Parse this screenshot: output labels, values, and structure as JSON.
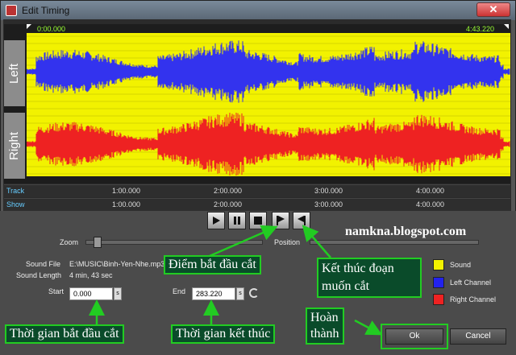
{
  "window": {
    "title": "Edit Timing",
    "close_label": "✕"
  },
  "waveform": {
    "start_time": "0:00.000",
    "end_time": "4:43.220",
    "left_label": "Left",
    "right_label": "Right",
    "left_color": "#3333ee",
    "right_color": "#ee2222",
    "bg_color": "#f2f200"
  },
  "rulers": {
    "track_label": "Track",
    "show_label": "Show",
    "ticks": [
      "1:00.000",
      "2:00.000",
      "3:00.000",
      "4:00.000"
    ]
  },
  "transport": {
    "icons": [
      "play-icon",
      "pause-icon",
      "stop-icon",
      "mark-start-icon",
      "mark-end-icon"
    ]
  },
  "zoom": {
    "label": "Zoom"
  },
  "position": {
    "label": "Position"
  },
  "info": {
    "sound_file_label": "Sound File",
    "sound_file_value": "E:\\MUSIC\\Binh-Yen-Nhe.mp3",
    "sound_length_label": "Sound Length",
    "sound_length_value": "4 min, 43 sec"
  },
  "start": {
    "label": "Start",
    "value": "0.000",
    "unit": "s"
  },
  "end": {
    "label": "End",
    "value": "283.220",
    "unit": "s"
  },
  "legend": [
    {
      "label": "Sound",
      "color": "#f2f200"
    },
    {
      "label": "Left Channel",
      "color": "#2222ee"
    },
    {
      "label": "Right Channel",
      "color": "#ee2222"
    }
  ],
  "buttons": {
    "ok": "Ok",
    "cancel": "Cancel"
  },
  "annotations": {
    "watermark": "namkna.blogspot.com",
    "start_point": "Điểm bắt đầu cắt",
    "end_segment_1": "Kết thúc đoạn",
    "end_segment_2": "muốn cắt",
    "start_time": "Thời gian bắt đầu cắt",
    "end_time": "Thời gian kết thúc",
    "done_1": "Hoàn",
    "done_2": "thành"
  }
}
